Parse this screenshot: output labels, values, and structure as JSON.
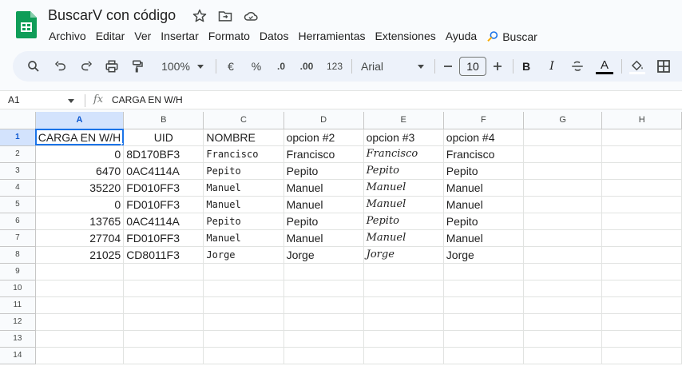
{
  "app": {
    "doc_title": "BuscarV con código",
    "star_icon": "star-icon",
    "move_icon": "folder-move-icon",
    "cloud_icon": "cloud-done-icon"
  },
  "menu": {
    "items": [
      "Archivo",
      "Editar",
      "Ver",
      "Insertar",
      "Formato",
      "Datos",
      "Herramientas",
      "Extensiones",
      "Ayuda"
    ],
    "search_label": "Buscar"
  },
  "toolbar": {
    "zoom": "100%",
    "currency": "€",
    "percent": "%",
    "decrease_decimals": ".0",
    "increase_decimals": ".00",
    "number_format": "123",
    "font": "Arial",
    "font_size": "10",
    "bold": "B",
    "italic": "I",
    "text_color_label": "A"
  },
  "formula_bar": {
    "cell_ref": "A1",
    "fx": "fx",
    "content": "CARGA EN W/H"
  },
  "sheet": {
    "columns": [
      "A",
      "B",
      "C",
      "D",
      "E",
      "F",
      "G",
      "H"
    ],
    "rows": [
      {
        "n": "1",
        "a": "CARGA EN W/H",
        "b": "UID",
        "c": "NOMBRE",
        "d": "opcion #2",
        "e": "opcion #3",
        "f": "opcion #4"
      },
      {
        "n": "2",
        "a": "0",
        "b": "8D170BF3",
        "c": "Francisco",
        "d": "Francisco",
        "e": "Francisco",
        "f": "Francisco"
      },
      {
        "n": "3",
        "a": "6470",
        "b": "0AC4114A",
        "c": "Pepito",
        "d": "Pepito",
        "e": "Pepito",
        "f": "Pepito"
      },
      {
        "n": "4",
        "a": "35220",
        "b": "FD010FF3",
        "c": "Manuel",
        "d": "Manuel",
        "e": "Manuel",
        "f": "Manuel"
      },
      {
        "n": "5",
        "a": "0",
        "b": "FD010FF3",
        "c": "Manuel",
        "d": "Manuel",
        "e": "Manuel",
        "f": "Manuel"
      },
      {
        "n": "6",
        "a": "13765",
        "b": "0AC4114A",
        "c": "Pepito",
        "d": "Pepito",
        "e": "Pepito",
        "f": "Pepito"
      },
      {
        "n": "7",
        "a": "27704",
        "b": "FD010FF3",
        "c": "Manuel",
        "d": "Manuel",
        "e": "Manuel",
        "f": "Manuel"
      },
      {
        "n": "8",
        "a": "21025",
        "b": "CD8011F3",
        "c": "Jorge",
        "d": "Jorge",
        "e": "Jorge",
        "f": "Jorge"
      },
      {
        "n": "9"
      },
      {
        "n": "10"
      },
      {
        "n": "11"
      },
      {
        "n": "12"
      },
      {
        "n": "13"
      },
      {
        "n": "14"
      }
    ]
  }
}
